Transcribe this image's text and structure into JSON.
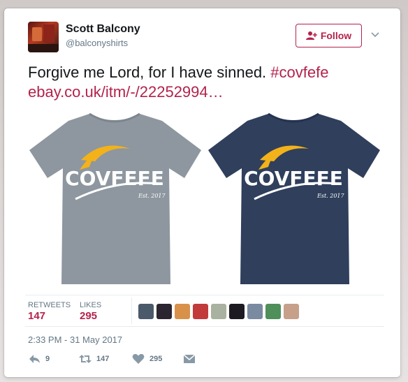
{
  "user": {
    "name": "Scott Balcony",
    "handle": "@balconyshirts",
    "follow_label": "Follow"
  },
  "tweet": {
    "text_before": "Forgive me Lord, for I have sinned. ",
    "hashtag": "#covfefe",
    "link": "ebay.co.uk/itm/-/22252994…"
  },
  "media": {
    "shirts": [
      {
        "logo_text": "COVFEFE",
        "sub_text": "Est. 2017",
        "color": "#8e979f"
      },
      {
        "logo_text": "COVFEFE",
        "sub_text": "Est. 2017",
        "color": "#2f3f5c"
      }
    ],
    "hair_color": "#f3b21a"
  },
  "stats": {
    "retweets_label": "RETWEETS",
    "retweets_value": "147",
    "likes_label": "LIKES",
    "likes_value": "295"
  },
  "likers": [
    {
      "name": "liker-avatar-1",
      "color": "#4a5a6a"
    },
    {
      "name": "liker-avatar-2",
      "color": "#2b2530"
    },
    {
      "name": "liker-avatar-3",
      "color": "#d9914a"
    },
    {
      "name": "liker-avatar-4",
      "color": "#c23a3a"
    },
    {
      "name": "liker-avatar-5",
      "color": "#a9b2a0"
    },
    {
      "name": "liker-avatar-6",
      "color": "#1d1a22"
    },
    {
      "name": "liker-avatar-7",
      "color": "#7a8aa0"
    },
    {
      "name": "liker-avatar-8",
      "color": "#4f8f5a"
    },
    {
      "name": "liker-avatar-9",
      "color": "#c7a08a"
    }
  ],
  "timestamp": "2:33 PM - 31 May 2017",
  "actions": {
    "reply_count": "9",
    "retweet_count": "147",
    "like_count": "295"
  },
  "colors": {
    "accent": "#b3224c",
    "text": "#14171a",
    "muted": "#657786"
  }
}
